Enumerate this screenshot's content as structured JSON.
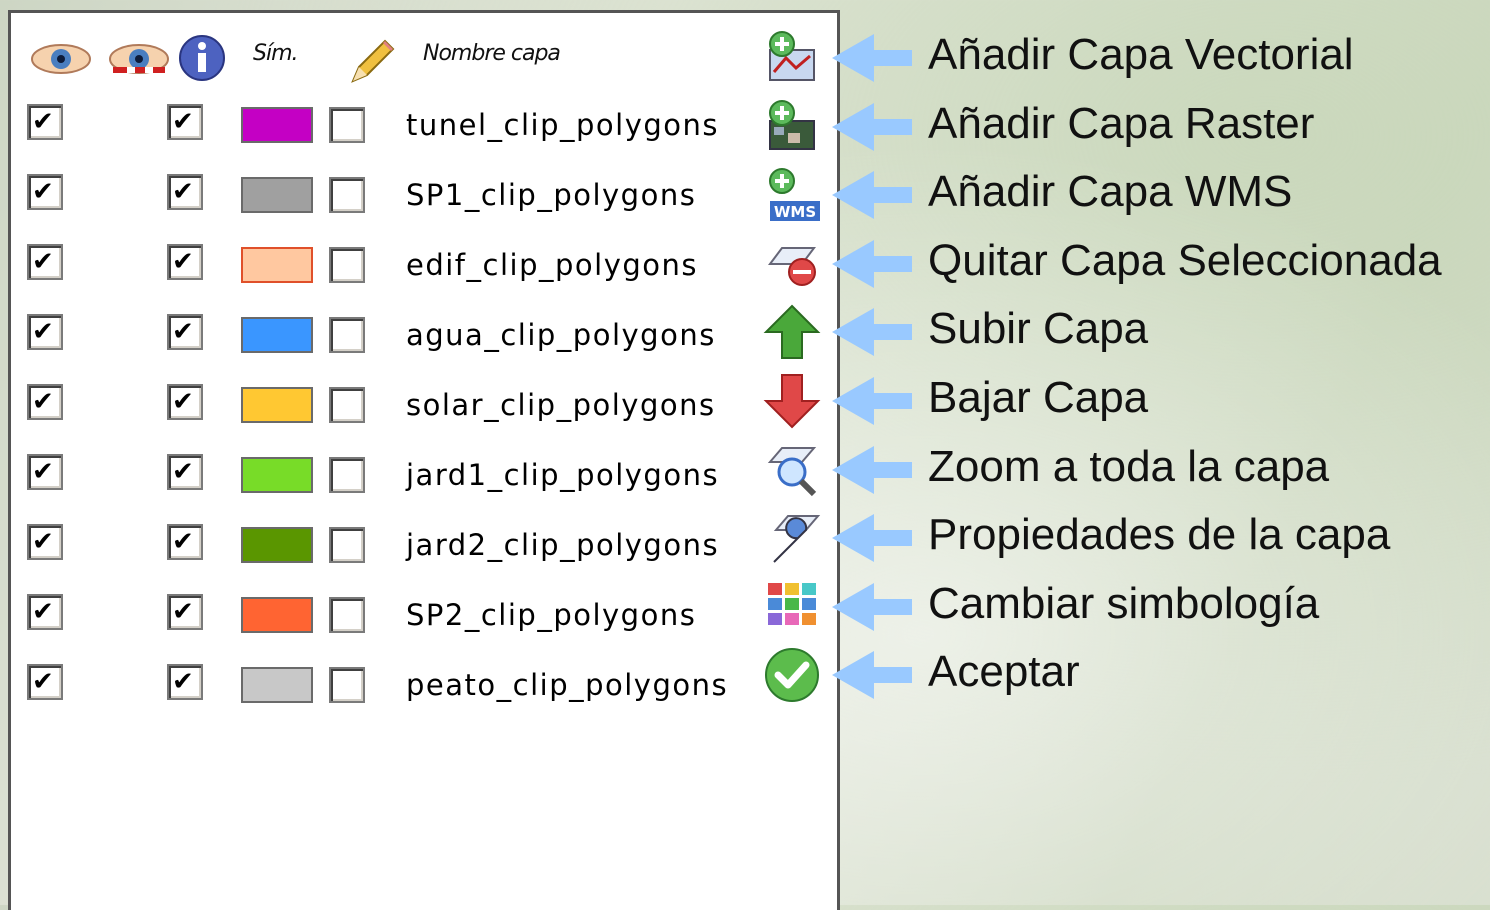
{
  "header": {
    "sym_label": "Sím.",
    "name_label": "Nombre capa",
    "icons": [
      "eye-icon",
      "eye-hidden-icon",
      "info-icon",
      "pencil-icon"
    ]
  },
  "layers": [
    {
      "name": "tunel_clip_polygons",
      "visible": true,
      "active": true,
      "color": "#c400c4",
      "edit": false
    },
    {
      "name": "SP1_clip_polygons",
      "visible": true,
      "active": true,
      "color": "#a0a0a0",
      "edit": false
    },
    {
      "name": "edif_clip_polygons",
      "visible": true,
      "active": true,
      "color": "#ffc8a0",
      "edit": false
    },
    {
      "name": "agua_clip_polygons",
      "visible": true,
      "active": true,
      "color": "#3a96ff",
      "edit": false
    },
    {
      "name": "solar_clip_polygons",
      "visible": true,
      "active": true,
      "color": "#ffc832",
      "edit": false
    },
    {
      "name": "jard1_clip_polygons",
      "visible": true,
      "active": true,
      "color": "#78dc28",
      "edit": false
    },
    {
      "name": "jard2_clip_polygons",
      "visible": true,
      "active": true,
      "color": "#5a9600",
      "edit": false
    },
    {
      "name": "SP2_clip_polygons",
      "visible": true,
      "active": true,
      "color": "#ff6432",
      "edit": false
    },
    {
      "name": "peato_clip_polygons",
      "visible": true,
      "active": true,
      "color": "#c8c8c8",
      "edit": false
    }
  ],
  "toolbar": [
    {
      "label": "Añadir Capa Vectorial",
      "icon": "add-vector-layer-icon"
    },
    {
      "label": "Añadir Capa Raster",
      "icon": "add-raster-layer-icon"
    },
    {
      "label": "Añadir Capa WMS",
      "icon": "add-wms-layer-icon",
      "icon_text": "WMS"
    },
    {
      "label": "Quitar Capa Seleccionada",
      "icon": "remove-layer-icon"
    },
    {
      "label": "Subir Capa",
      "icon": "arrow-up-icon"
    },
    {
      "label": "Bajar Capa",
      "icon": "arrow-down-icon"
    },
    {
      "label": "Zoom a toda la capa",
      "icon": "zoom-layer-icon"
    },
    {
      "label": "Propiedades de la capa",
      "icon": "layer-properties-icon"
    },
    {
      "label": "Cambiar simbología",
      "icon": "symbology-icon"
    },
    {
      "label": "Aceptar",
      "icon": "accept-icon"
    }
  ],
  "colors": {
    "arrow": "#99c9ff",
    "check": "#000000",
    "panel_border": "#555555"
  }
}
